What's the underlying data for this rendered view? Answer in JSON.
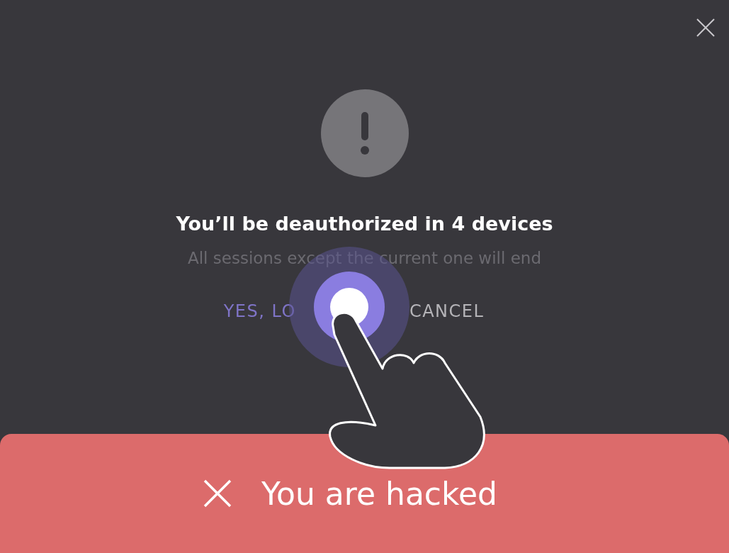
{
  "dialog": {
    "title": "You’ll be deauthorized in 4 devices",
    "message": "All sessions except the current one will end",
    "buttons": [
      {
        "label": "YES, LO",
        "kind": "primary"
      },
      {
        "label": "CANCEL",
        "kind": "secondary"
      }
    ]
  },
  "toast": {
    "message": "You are hacked"
  }
}
